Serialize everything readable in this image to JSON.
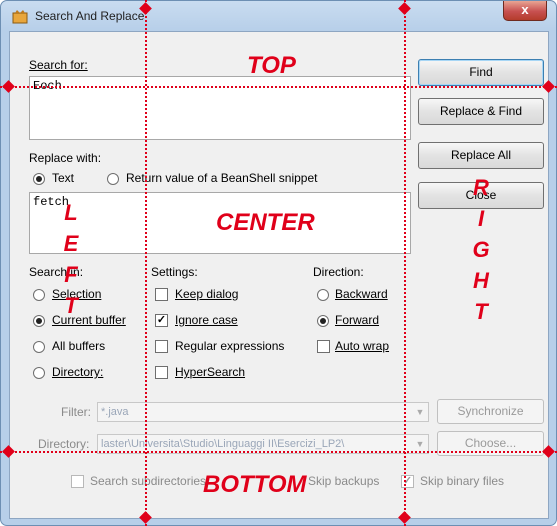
{
  "window": {
    "title": "Search And Replace",
    "close_glyph": "x"
  },
  "search": {
    "label": "Search for:",
    "value": "Eoch"
  },
  "replace": {
    "label": "Replace with:",
    "mode_text": "Text",
    "mode_beanshell": "Return value of a BeanShell snippet",
    "value": "fetch"
  },
  "buttons": {
    "find": "Find",
    "replace_find": "Replace & Find",
    "replace_all": "Replace All",
    "close": "Close"
  },
  "search_in": {
    "header": "Search in:",
    "selection": "Selection",
    "current_buffer": "Current buffer",
    "all_buffers": "All buffers",
    "directory": "Directory:"
  },
  "settings": {
    "header": "Settings:",
    "keep_dialog": "Keep dialog",
    "ignore_case": "Ignore case",
    "regex": "Regular expressions",
    "hypersearch": "HyperSearch"
  },
  "direction": {
    "header": "Direction:",
    "backward": "Backward",
    "forward": "Forward",
    "auto_wrap": "Auto wrap"
  },
  "filter": {
    "label": "Filter:",
    "value": "*.java",
    "button": "Synchronize"
  },
  "directory": {
    "label": "Directory:",
    "value": "laster\\Universita\\Studio\\Linguaggi II\\Esercizi_LP2\\",
    "button": "Choose..."
  },
  "bottom": {
    "subdirs": "Search subdirectories",
    "skip_backups": "Skip backups",
    "skip_binary": "Skip binary files"
  },
  "annotations": {
    "top": "TOP",
    "center": "CENTER",
    "bottom": "BOTTOM",
    "left": [
      "L",
      "E",
      "F",
      "T"
    ],
    "right": [
      "R",
      "I",
      "G",
      "H",
      "T"
    ],
    "color": "#e0001a"
  },
  "state": {
    "replace_mode": "text",
    "search_in": "current_buffer",
    "direction": "forward",
    "keep_dialog": false,
    "ignore_case": true,
    "regex": false,
    "hypersearch": false,
    "auto_wrap": false,
    "skip_binary": true
  }
}
